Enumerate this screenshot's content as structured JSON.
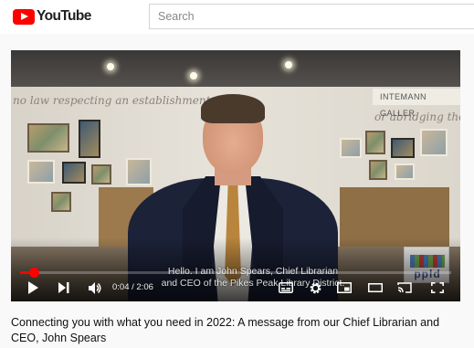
{
  "header": {
    "logo_text": "YouTube",
    "search_placeholder": "Search",
    "brand_color": "#ff0000"
  },
  "player": {
    "wall_text_left": "no law respecting an establishment",
    "wall_text_right": "or abridging the fre",
    "gallery_sign": "INTEMANN GALLER",
    "caption_line1": "Hello. I am John Spears, Chief Librarian",
    "caption_line2": "and CEO of the Pikes Peak Library District.",
    "watermark_text": "ppld",
    "current_time": "0:04",
    "separator": " / ",
    "duration": "2:06",
    "progress_fraction": 0.032,
    "icons": [
      "play-icon",
      "next-icon",
      "volume-icon",
      "subtitles-icon",
      "settings-icon",
      "miniplayer-icon",
      "theater-icon",
      "cast-icon",
      "fullscreen-icon"
    ]
  },
  "video": {
    "title": "Connecting you with what you need in 2022: A message from our Chief Librarian and CEO, John Spears"
  }
}
